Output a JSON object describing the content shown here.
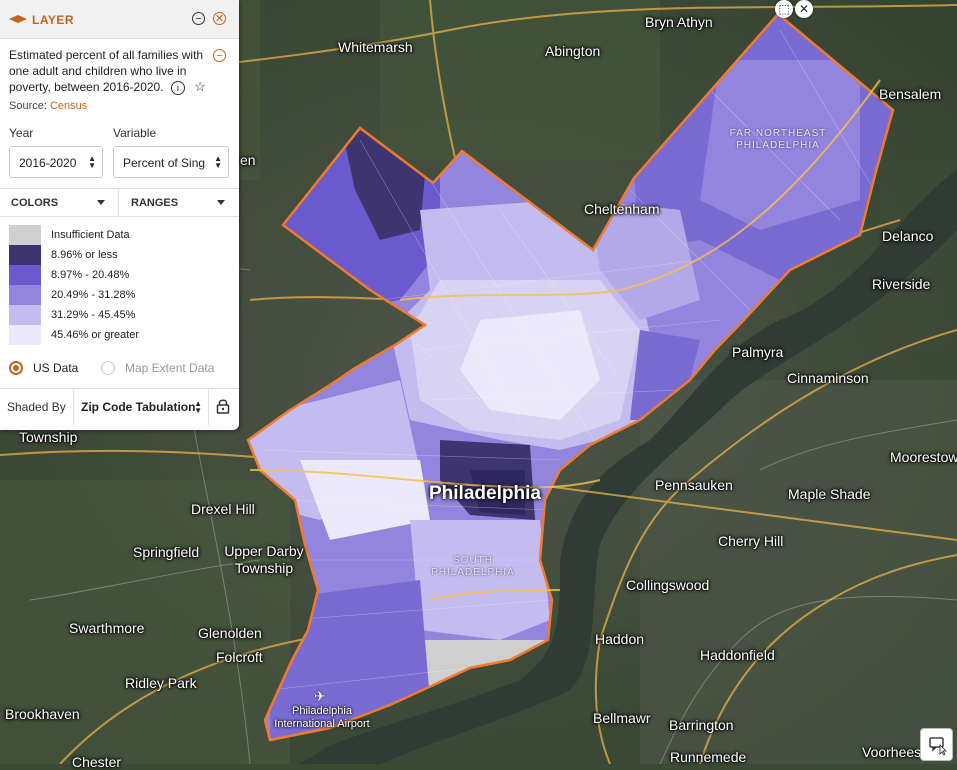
{
  "panel": {
    "header_title": "LAYER",
    "description": "Estimated percent of all families with one adult and children who live in poverty, between 2016-2020.",
    "source_label": "Source:",
    "source_link": "Census",
    "year_label": "Year",
    "year_value": "2016-2020",
    "variable_label": "Variable",
    "variable_value": "Percent of Sing",
    "tab_colors": "COLORS",
    "tab_ranges": "RANGES",
    "legend": [
      {
        "label": "Insufficient Data",
        "color": "#cfcfcf"
      },
      {
        "label": "8.96% or less",
        "color": "#3d3470"
      },
      {
        "label": "8.97% - 20.48%",
        "color": "#6a5acd"
      },
      {
        "label": "20.49% - 31.28%",
        "color": "#9384dd"
      },
      {
        "label": "31.29% - 45.45%",
        "color": "#c4bbee"
      },
      {
        "label": "45.46% or greater",
        "color": "#ece9fa"
      }
    ],
    "radio_us": "US Data",
    "radio_extent": "Map Extent Data",
    "shaded_by_label": "Shaded By",
    "shaded_by_value": "Zip Code Tabulation",
    "accent_color": "#c4651f"
  },
  "map": {
    "boundary_color": "#f07a2e",
    "places": [
      "Whitemarsh",
      "Abington",
      "Bryn Athyn",
      "Bensalem",
      "Cheltenham",
      "Delanco",
      "Riverside",
      "Palmyra",
      "Cinnaminson",
      "Moorestown",
      "Pennsauken",
      "Maple Shade",
      "Cherry Hill",
      "Collingswood",
      "Haddon",
      "Haddonfield",
      "Bellmawr",
      "Barrington",
      "Runnemede",
      "Voorhees",
      "Township",
      "Drexel Hill",
      "Springfield",
      "Upper Darby Township",
      "Swarthmore",
      "Glenolden",
      "Folcroft",
      "Ridley Park",
      "Brookhaven",
      "Chester",
      "en"
    ],
    "districts": [
      "FAR NORTHEAST PHILADELPHIA",
      "SOUTH PHILADELPHIA"
    ],
    "city": "Philadelphia",
    "airport": "Philadelphia International Airport"
  }
}
